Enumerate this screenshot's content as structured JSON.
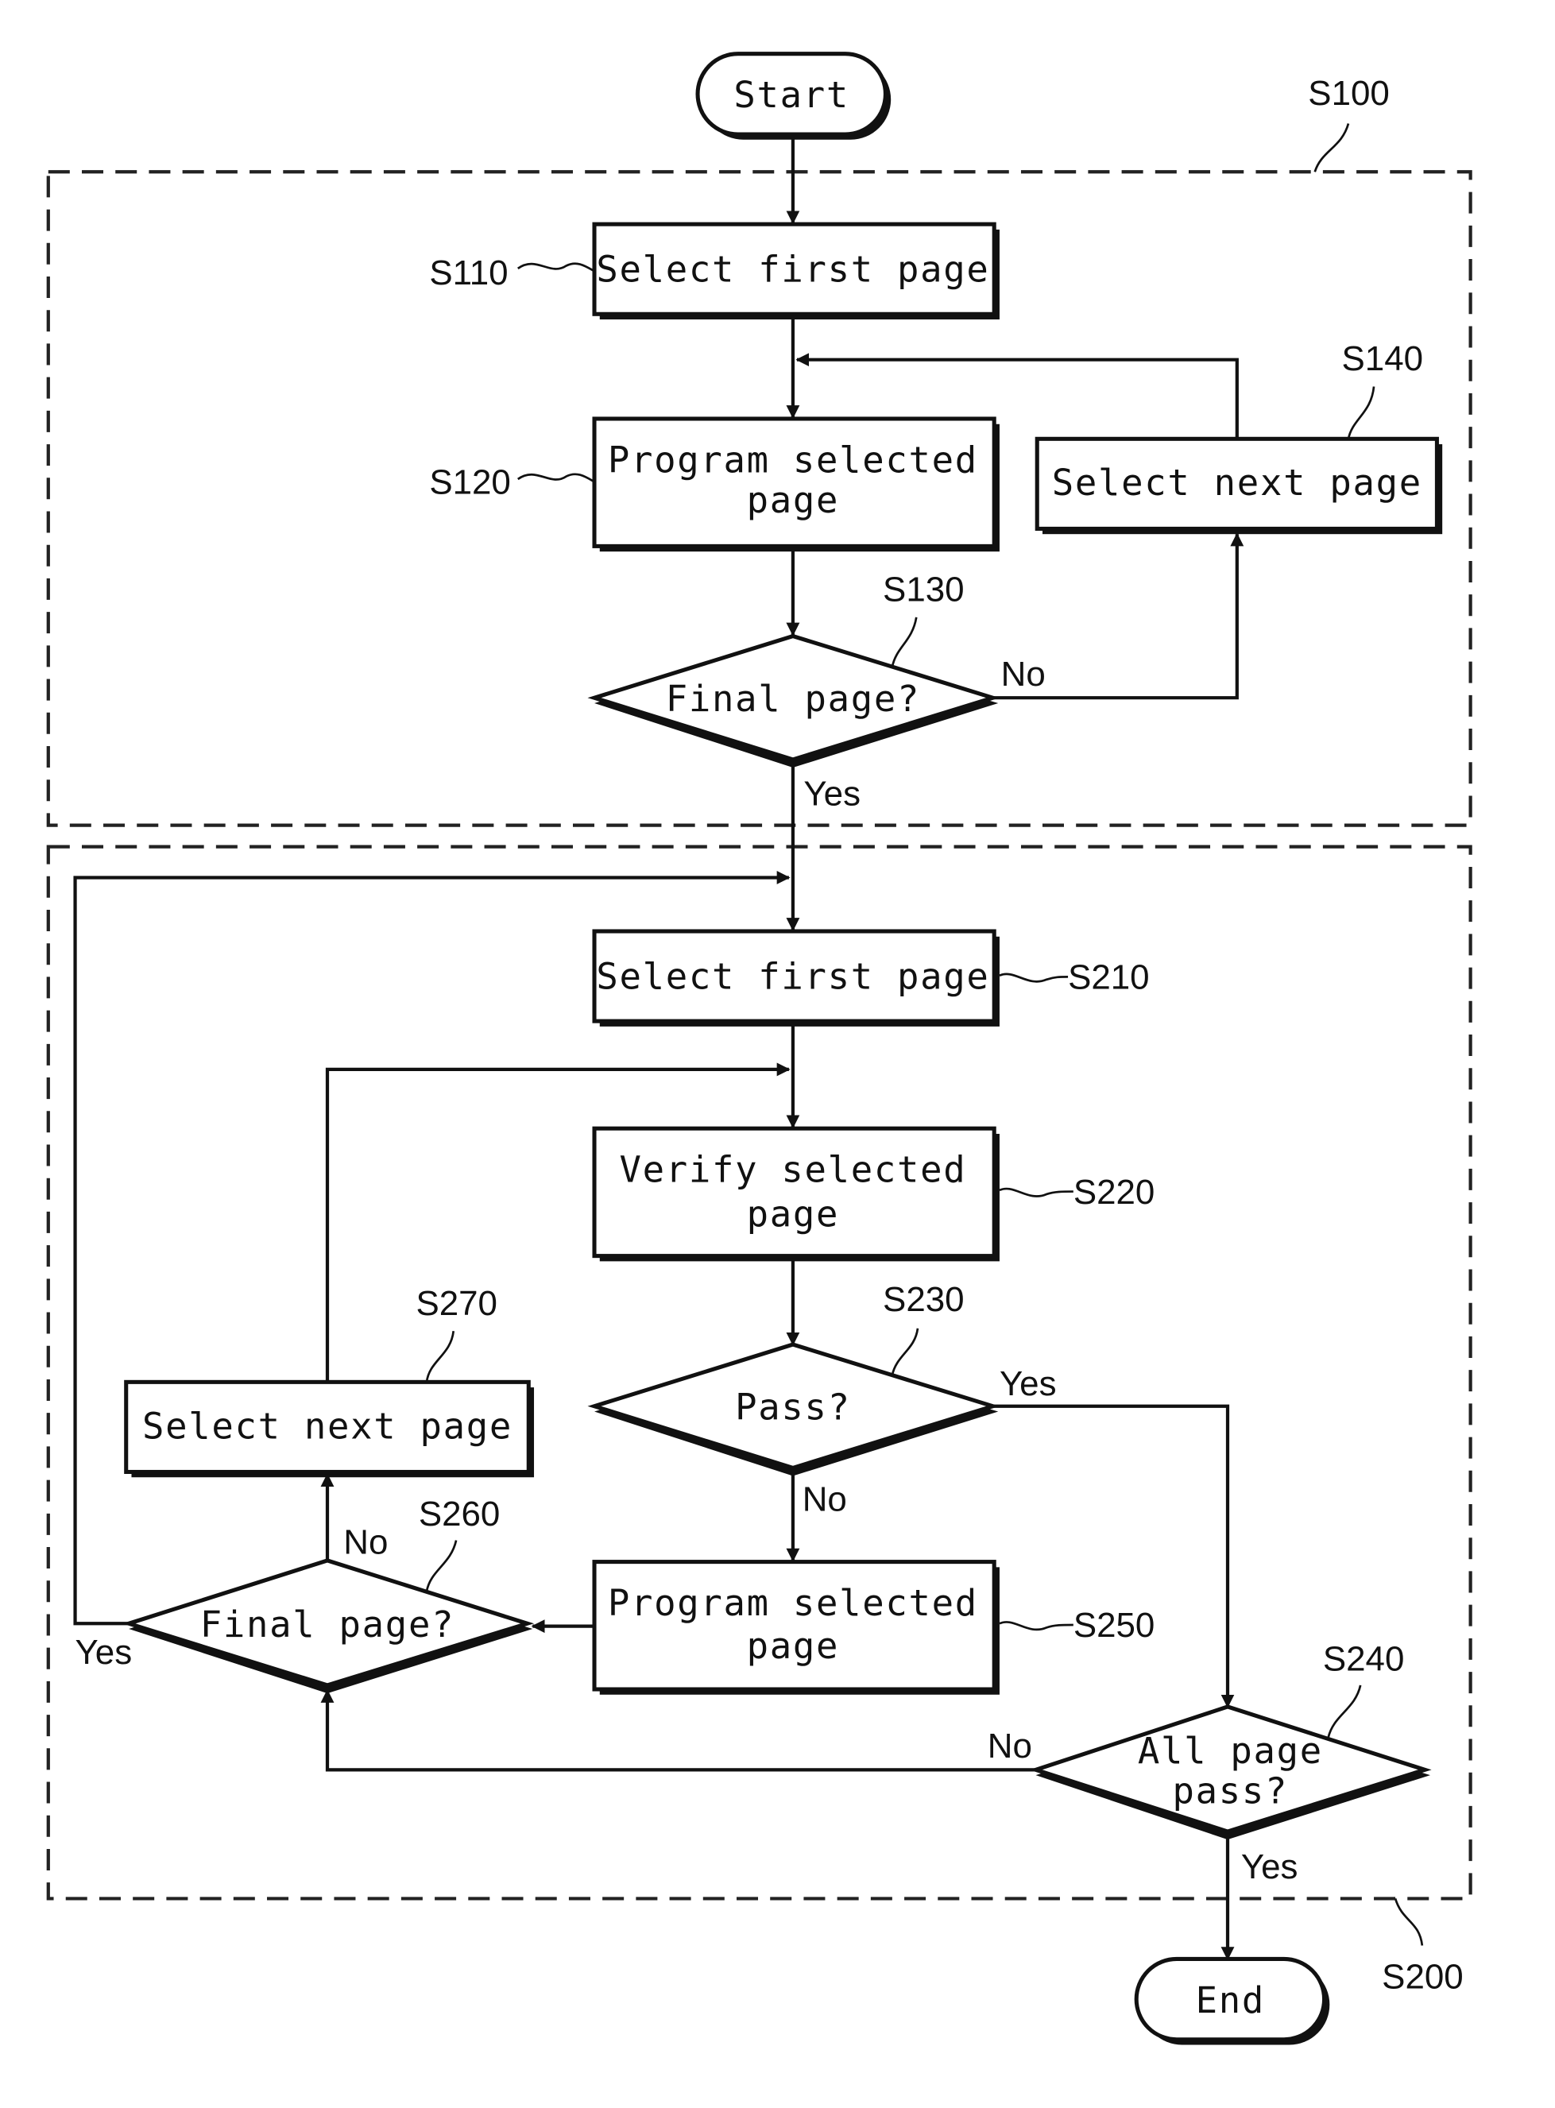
{
  "diagram": {
    "type": "flowchart",
    "terminals": {
      "start": "Start",
      "end": "End"
    },
    "groups": [
      {
        "id": "S100",
        "label": "S100"
      },
      {
        "id": "S200",
        "label": "S200"
      }
    ],
    "steps": {
      "s110": {
        "ref": "S110",
        "line1": "Select first page",
        "line2": ""
      },
      "s120": {
        "ref": "S120",
        "line1": "Program selected",
        "line2": "page"
      },
      "s130": {
        "ref": "S130",
        "line1": "Final page?",
        "line2": ""
      },
      "s140": {
        "ref": "S140",
        "line1": "Select next page",
        "line2": ""
      },
      "s210": {
        "ref": "S210",
        "line1": "Select first page",
        "line2": ""
      },
      "s220": {
        "ref": "S220",
        "line1": "Verify selected",
        "line2": "page"
      },
      "s230": {
        "ref": "S230",
        "line1": "Pass?",
        "line2": ""
      },
      "s240": {
        "ref": "S240",
        "line1": "All page",
        "line2": "pass?"
      },
      "s250": {
        "ref": "S250",
        "line1": "Program selected",
        "line2": "page"
      },
      "s260": {
        "ref": "S260",
        "line1": "Final page?",
        "line2": ""
      },
      "s270": {
        "ref": "S270",
        "line1": "Select next page",
        "line2": ""
      }
    },
    "edge_labels": {
      "s130_no": "No",
      "s130_yes": "Yes",
      "s230_yes": "Yes",
      "s230_no": "No",
      "s240_no": "No",
      "s240_yes": "Yes",
      "s260_no": "No",
      "s260_yes": "Yes"
    }
  }
}
